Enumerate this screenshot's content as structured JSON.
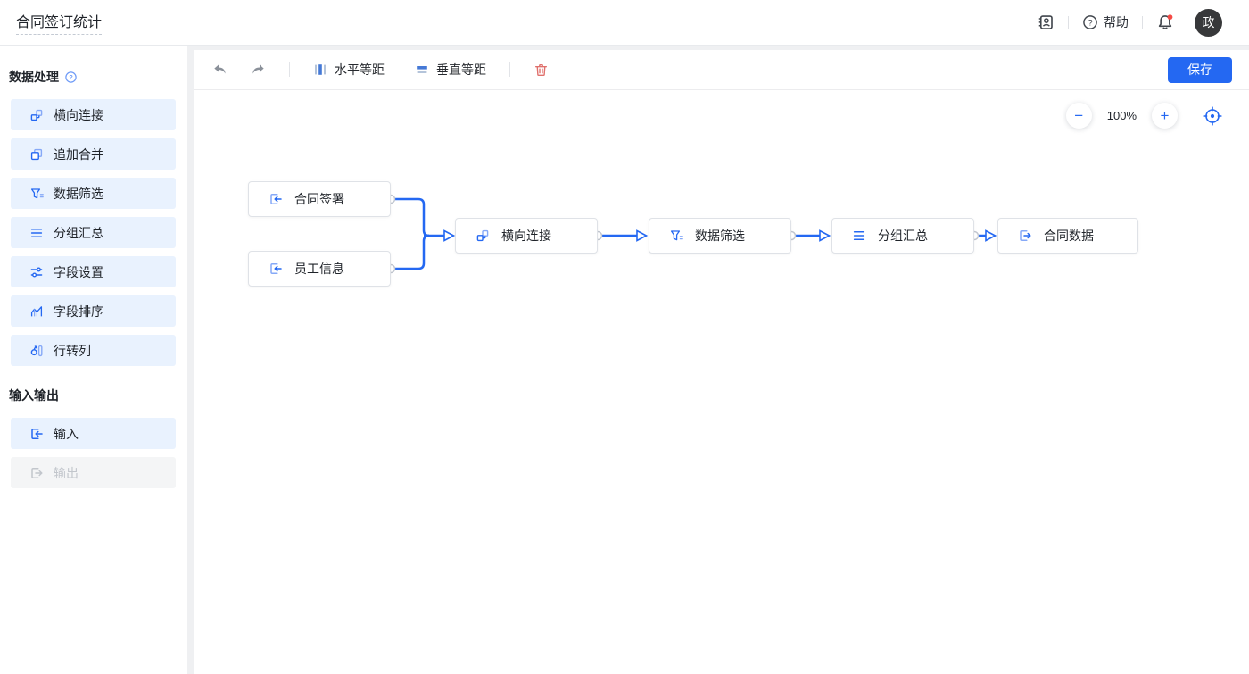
{
  "header": {
    "title": "合同签订统计",
    "help_label": "帮助",
    "avatar_text": "政"
  },
  "sidebar": {
    "sections": [
      {
        "title": "数据处理",
        "items": [
          {
            "label": "横向连接",
            "icon": "join-icon"
          },
          {
            "label": "追加合并",
            "icon": "append-merge-icon"
          },
          {
            "label": "数据筛选",
            "icon": "filter-icon"
          },
          {
            "label": "分组汇总",
            "icon": "group-summary-icon"
          },
          {
            "label": "字段设置",
            "icon": "field-settings-icon"
          },
          {
            "label": "字段排序",
            "icon": "field-sort-icon"
          },
          {
            "label": "行转列",
            "icon": "row-to-column-icon"
          }
        ]
      },
      {
        "title": "输入输出",
        "items": [
          {
            "label": "输入",
            "icon": "input-icon",
            "disabled": false
          },
          {
            "label": "输出",
            "icon": "output-icon",
            "disabled": true
          }
        ]
      }
    ]
  },
  "toolbar": {
    "distribute_h_label": "水平等距",
    "distribute_v_label": "垂直等距",
    "save_label": "保存"
  },
  "canvas": {
    "zoom_level": "100%",
    "nodes": [
      {
        "label": "合同签署",
        "type": "input"
      },
      {
        "label": "员工信息",
        "type": "input"
      },
      {
        "label": "横向连接",
        "type": "join"
      },
      {
        "label": "数据筛选",
        "type": "filter"
      },
      {
        "label": "分组汇总",
        "type": "group-summary"
      },
      {
        "label": "合同数据",
        "type": "output"
      }
    ]
  },
  "colors": {
    "accent": "#2468F2",
    "sidebar_item_bg": "#E9F2FE",
    "danger": "#E0706C",
    "avatar_bg": "#37383A",
    "notification_dot": "#F54A45"
  }
}
